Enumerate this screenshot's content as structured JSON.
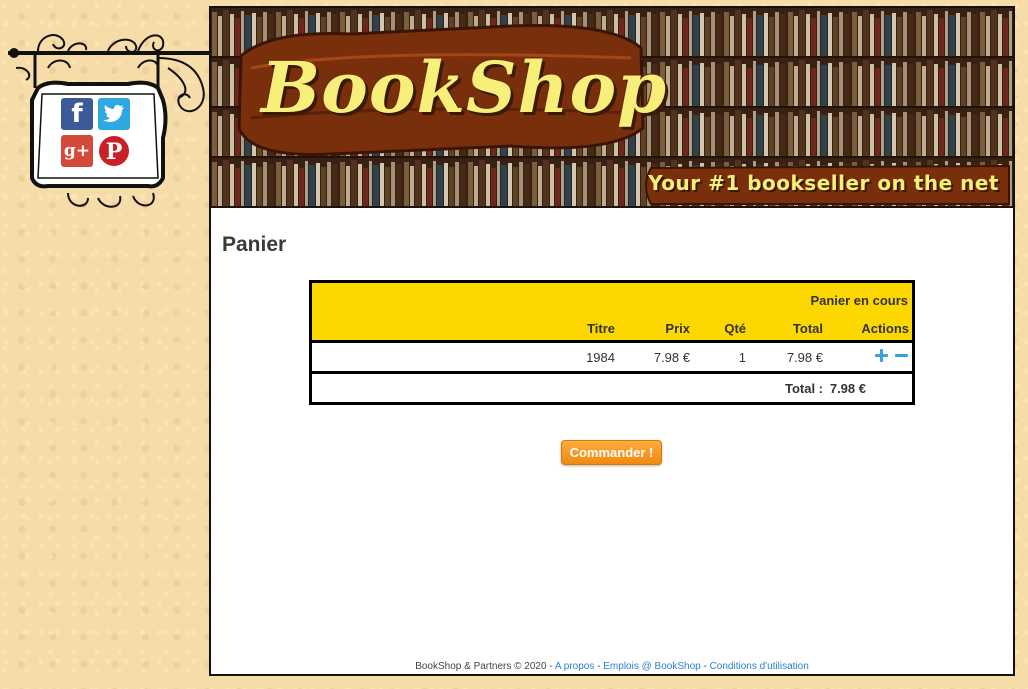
{
  "header": {
    "logo": "BookShop",
    "tagline": "Your #1 bookseller on the net"
  },
  "social": {
    "facebook": "f",
    "twitter": "twitter-bird",
    "googleplus": "g+",
    "pinterest": "P"
  },
  "page": {
    "title": "Panier"
  },
  "cart": {
    "caption": "Panier en cours",
    "columns": {
      "titre": "Titre",
      "prix": "Prix",
      "qte": "Qté",
      "total": "Total",
      "actions": "Actions"
    },
    "rows": [
      {
        "titre": "1984",
        "prix": "7.98 €",
        "qte": "1",
        "total": "7.98 €"
      }
    ],
    "total_label": "Total :",
    "total_value": "7.98 €",
    "colors": {
      "header": "#fdd800",
      "action_icon": "#3a9ee0"
    }
  },
  "order_button": "Commander !",
  "footer": {
    "text": "BookShop & Partners © 2020 - ",
    "sep1": " - ",
    "sep2": " - ",
    "link_about": "A propos",
    "link_jobs": "Emplois @ BookShop",
    "link_terms": "Conditions d'utilisation"
  }
}
